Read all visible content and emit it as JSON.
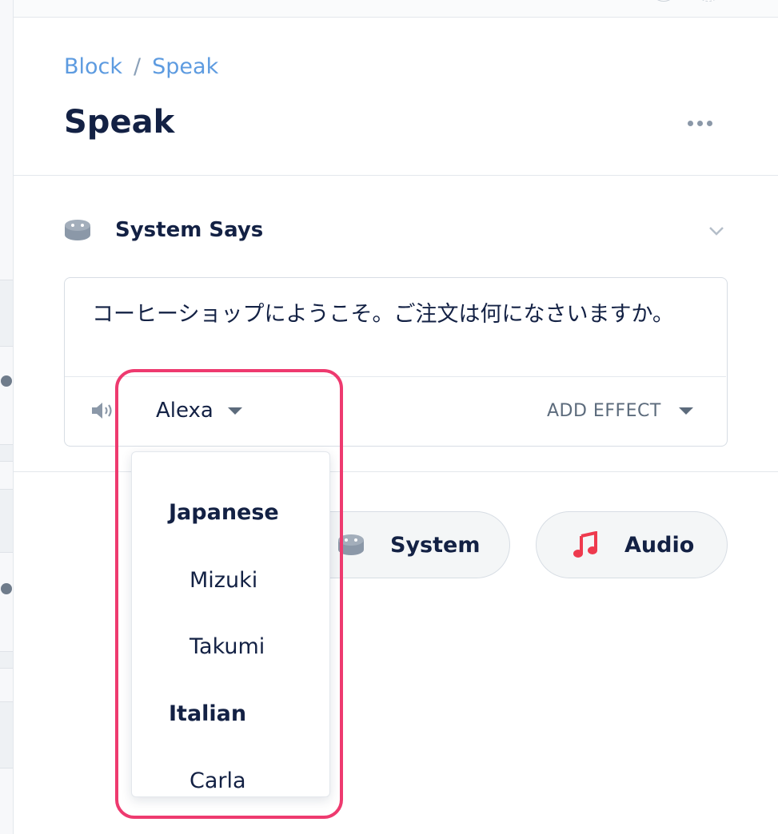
{
  "breadcrumb": {
    "root": "Block",
    "separator": "/",
    "current": "Speak"
  },
  "page": {
    "title": "Speak"
  },
  "section": {
    "title": "System Says",
    "icon": "robot-head-icon"
  },
  "speak": {
    "text": "コーヒーショップにようこそ。ご注文は何になさいますか。",
    "voice_selected": "Alexa",
    "add_effect_label": "ADD EFFECT"
  },
  "add_buttons": [
    {
      "label": "System",
      "icon": "robot-head-icon"
    },
    {
      "label": "Audio",
      "icon": "music-note-icon",
      "icon_color": "#ee3a4e"
    }
  ],
  "voice_dropdown": {
    "groups": [
      {
        "label": "Japanese",
        "items": [
          "Mizuki",
          "Takumi"
        ]
      },
      {
        "label": "Italian",
        "items": [
          "Carla"
        ]
      }
    ]
  },
  "colors": {
    "link": "#5d9be0",
    "text": "#132144",
    "highlight": "#ee3a6f",
    "muted": "#5c6b7c"
  }
}
